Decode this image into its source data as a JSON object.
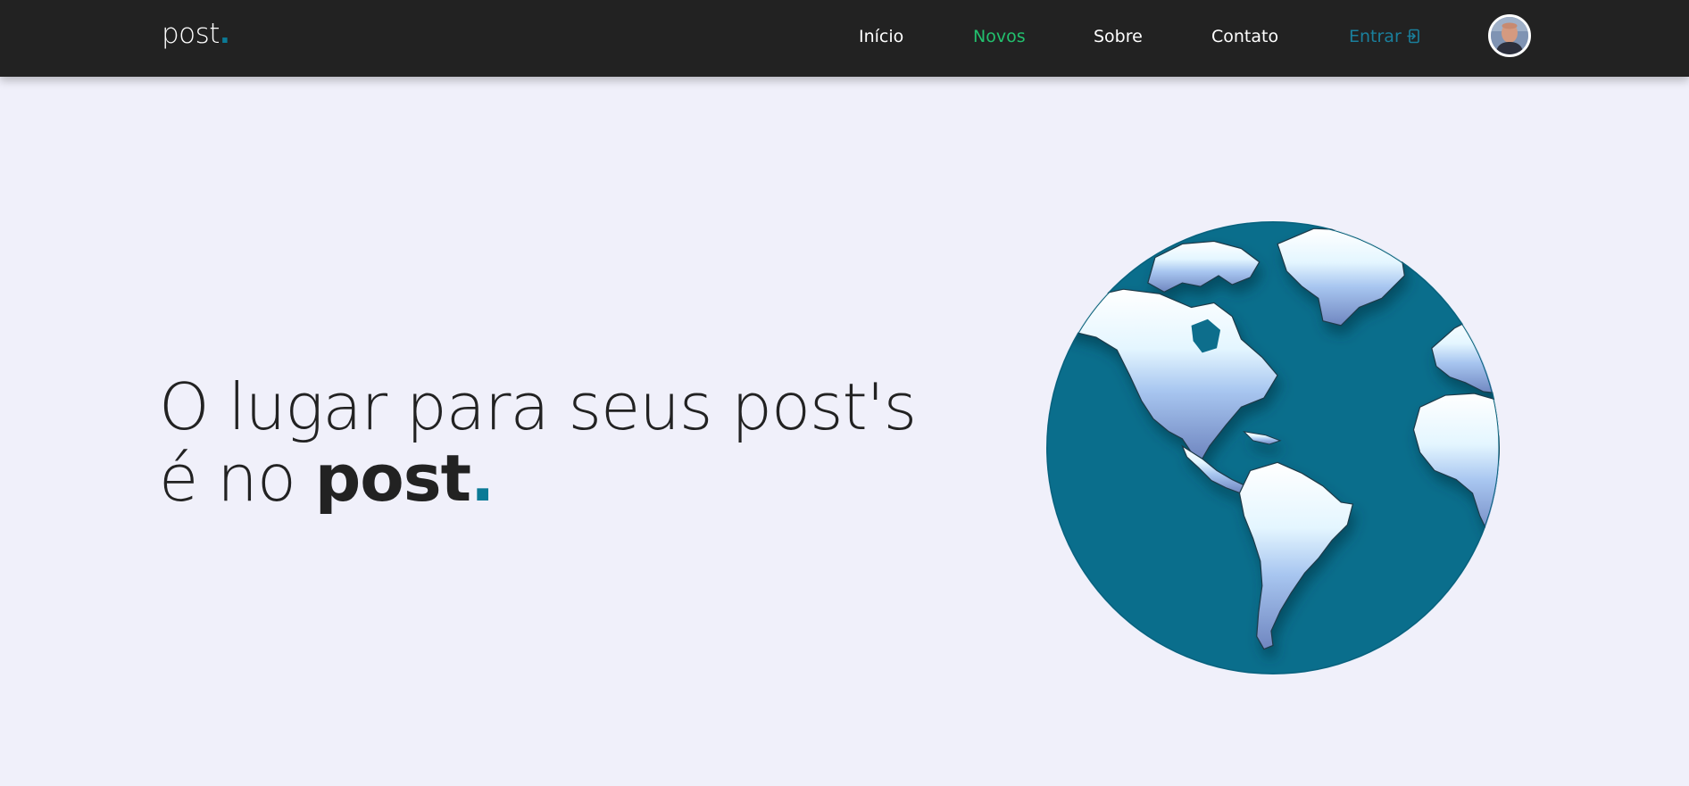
{
  "nav": {
    "logo_text": "post",
    "logo_dot": ".",
    "links": [
      {
        "label": "Início"
      },
      {
        "label": "Novos"
      },
      {
        "label": "Sobre"
      },
      {
        "label": "Contato"
      }
    ],
    "login_label": "Entrar",
    "login_icon": "login-icon",
    "avatar_icon": "user-avatar"
  },
  "hero": {
    "line1": "O lugar para seus post's",
    "line2_prefix": "é no ",
    "line2_bold": "post",
    "line2_dot": "."
  },
  "colors": {
    "navbar_bg": "#222222",
    "page_bg": "#f0f0fa",
    "accent": "#0b7a96",
    "active_link": "#22c06e",
    "login_link": "#1a7f9c",
    "ocean": "#0a6e8c"
  },
  "illustration": {
    "name": "globe-americas"
  }
}
